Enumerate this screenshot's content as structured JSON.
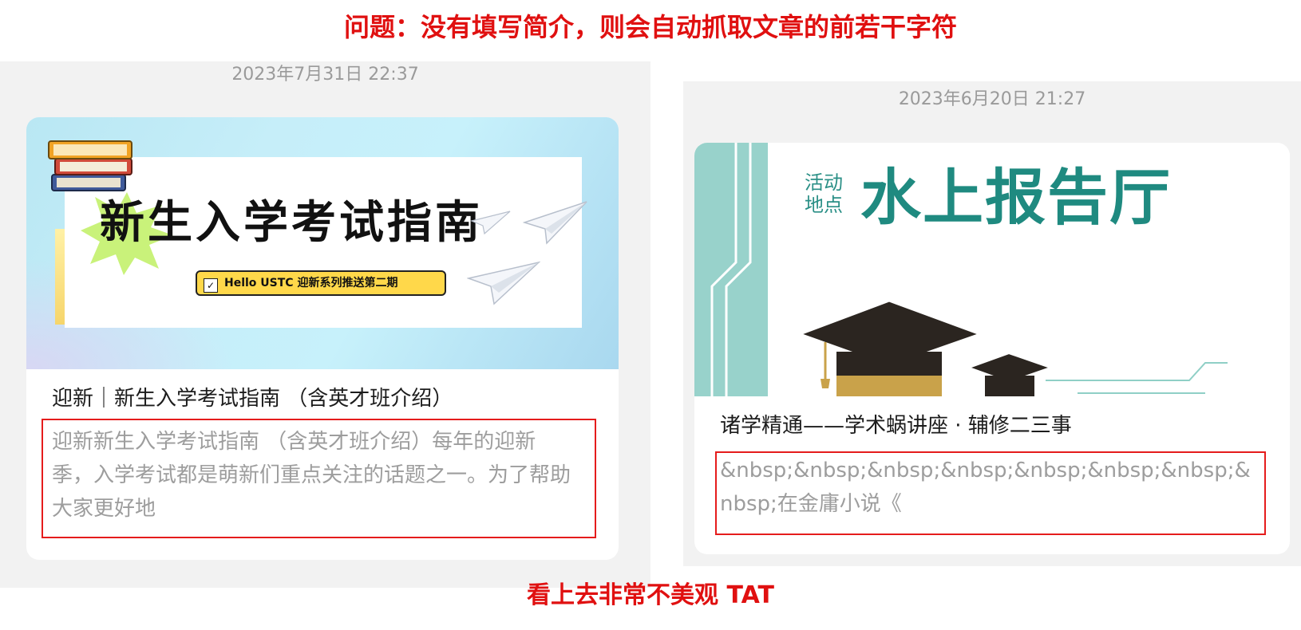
{
  "heading": "问题：没有填写简介，则会自动抓取文章的前若干字符",
  "footer": "看上去非常不美观 TAT",
  "cards": [
    {
      "timestamp": "2023年7月31日 22:37",
      "cover": {
        "title": "新生入学考试指南",
        "badge": "Hello USTC  迎新系列推送第二期"
      },
      "title": "迎新｜新生入学考试指南 （含英才班介绍）",
      "description": "迎新新生入学考试指南 （含英才班介绍）每年的迎新季，入学考试都是萌新们重点关注的话题之一。为了帮助大家更好地"
    },
    {
      "timestamp": "2023年6月20日 21:27",
      "cover": {
        "label": "活动地点",
        "place": "水上报告厅"
      },
      "title": "诸学精通——学术蜗讲座 · 辅修二三事",
      "description": "&nbsp;&nbsp;&nbsp;&nbsp;&nbsp;&nbsp;&nbsp;&nbsp;在金庸小说《"
    }
  ],
  "colors": {
    "annotation_red": "#e01010",
    "panel_bg": "#f2f2f2",
    "teal": "#1f8a80"
  }
}
